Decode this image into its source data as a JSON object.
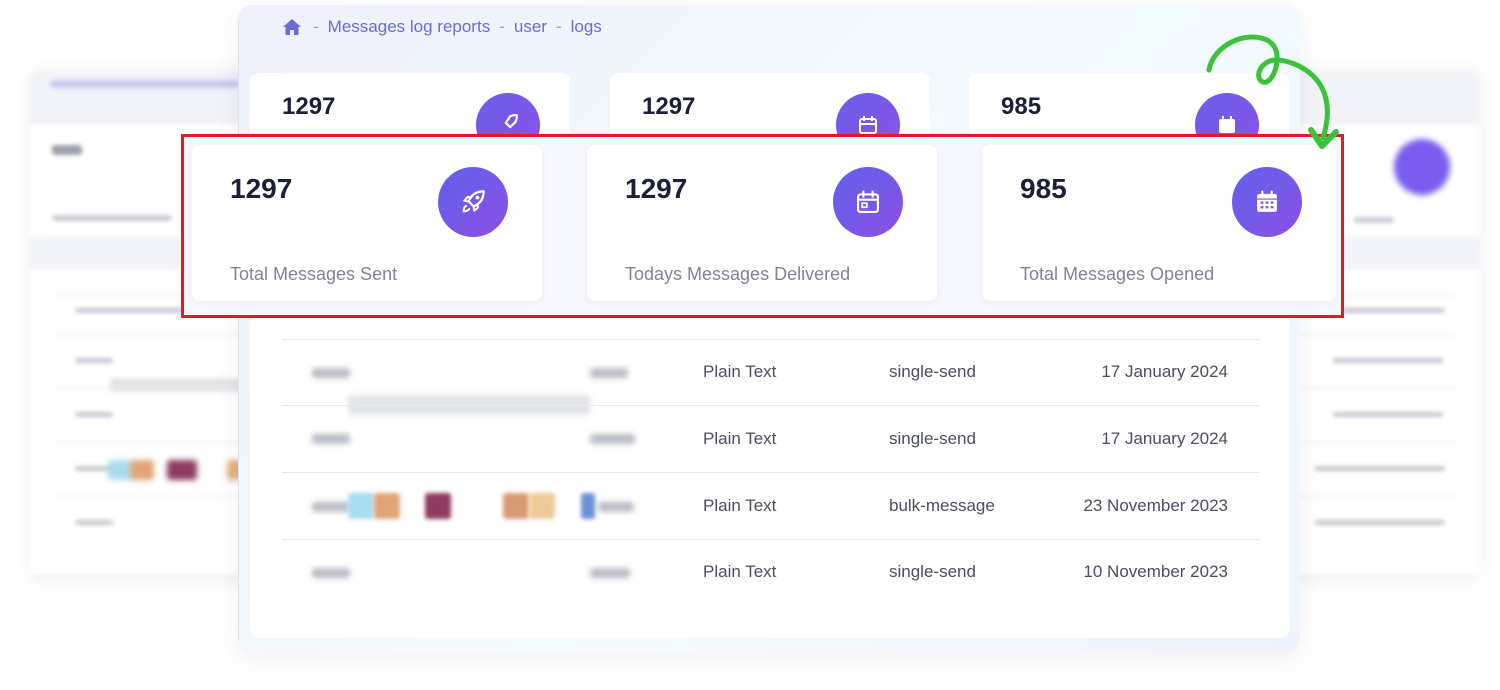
{
  "breadcrumb": {
    "items": [
      "Messages log reports",
      "user",
      "logs"
    ],
    "separator": "-"
  },
  "stats_preview": [
    {
      "value": "1297",
      "icon": "rocket-icon"
    },
    {
      "value": "1297",
      "icon": "calendar-icon"
    },
    {
      "value": "985",
      "icon": "calendar-grid-icon"
    }
  ],
  "stats": [
    {
      "value": "1297",
      "label": "Total Messages Sent",
      "icon": "rocket-icon"
    },
    {
      "value": "1297",
      "label": "Todays Messages Delivered",
      "icon": "calendar-icon"
    },
    {
      "value": "985",
      "label": "Total Messages Opened",
      "icon": "calendar-grid-icon"
    }
  ],
  "log_rows": [
    {
      "type": "Plain Text",
      "mode": "single-send",
      "date": "17 January 2024"
    },
    {
      "type": "Plain Text",
      "mode": "single-send",
      "date": "17 January 2024"
    },
    {
      "type": "Plain Text",
      "mode": "bulk-message",
      "date": "23 November 2023"
    },
    {
      "type": "Plain Text",
      "mode": "single-send",
      "date": "10 November 2023"
    }
  ],
  "background": {
    "card_value": "1297"
  },
  "colors": {
    "accent": "#6a5ee8",
    "highlight_border": "#e11b22",
    "annotation_arrow": "#3cc23a",
    "breadcrumb": "#6a6cd8"
  }
}
